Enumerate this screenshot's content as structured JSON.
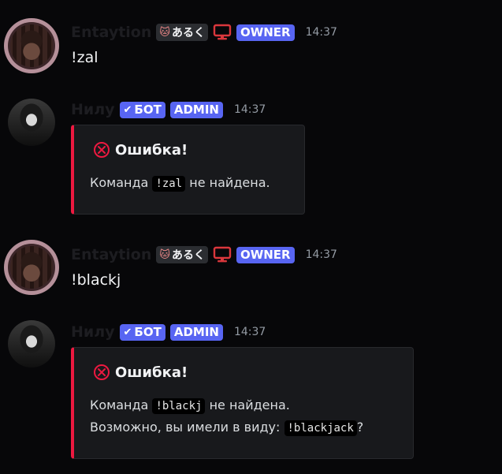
{
  "messages": [
    {
      "username": "Entaytion",
      "tag": "あるく",
      "badge": "OWNER",
      "time": "14:37",
      "text": "!zal"
    },
    {
      "username": "Нилу",
      "bot_badge": "БОТ",
      "role_badge": "ADMIN",
      "time": "14:37",
      "embed": {
        "title": "Ошибка!",
        "line1_prefix": "Команда",
        "line1_code": "!zal",
        "line1_suffix": "не найдена."
      }
    },
    {
      "username": "Entaytion",
      "tag": "あるく",
      "badge": "OWNER",
      "time": "14:37",
      "text": "!blackj"
    },
    {
      "username": "Нилу",
      "bot_badge": "БОТ",
      "role_badge": "ADMIN",
      "time": "14:37",
      "embed": {
        "title": "Ошибка!",
        "line1_prefix": "Команда",
        "line1_code": "!blackj",
        "line1_suffix": "не найдена.",
        "line2_prefix": "Возможно, вы имели в виду:",
        "line2_code": "!blackjack",
        "line2_suffix": "?"
      }
    }
  ],
  "colors": {
    "background": "#070709",
    "badge": "#5865f2",
    "embed_accent": "#ed1940",
    "monitor_icon": "#da373c"
  },
  "icons": {
    "tag": "cat-icon",
    "device": "monitor-icon",
    "bot": "check-icon",
    "error": "error-circle-icon"
  }
}
